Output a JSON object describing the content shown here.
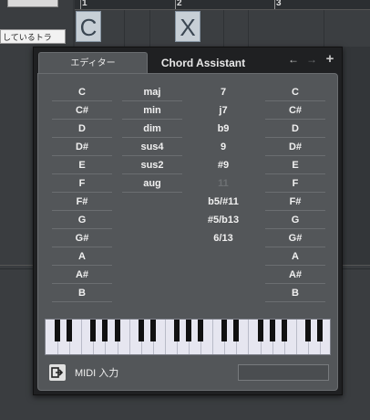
{
  "background": {
    "track_label": "しているトラ",
    "ruler_numbers": [
      "1",
      "2",
      "3"
    ],
    "chord_events": [
      "C",
      "X"
    ]
  },
  "tabs": {
    "editor": "エディター",
    "chord_assistant": "Chord Assistant"
  },
  "nav": {
    "back_icon": "←",
    "forward_icon": "→",
    "add_icon": "+"
  },
  "columns": {
    "root": [
      "C",
      "C#",
      "D",
      "D#",
      "E",
      "F",
      "F#",
      "G",
      "G#",
      "A",
      "A#",
      "B"
    ],
    "type": [
      "maj",
      "min",
      "dim",
      "sus4",
      "sus2",
      "aug"
    ],
    "tension": [
      "7",
      "j7",
      "b9",
      "9",
      "#9",
      "11",
      "b5/#11",
      "#5/b13",
      "6/13"
    ],
    "bass": [
      "C",
      "C#",
      "D",
      "D#",
      "E",
      "F",
      "F#",
      "G",
      "G#",
      "A",
      "A#",
      "B"
    ]
  },
  "tension_disabled_index": 5,
  "midi": {
    "label": "MIDI 入力",
    "field_value": ""
  }
}
